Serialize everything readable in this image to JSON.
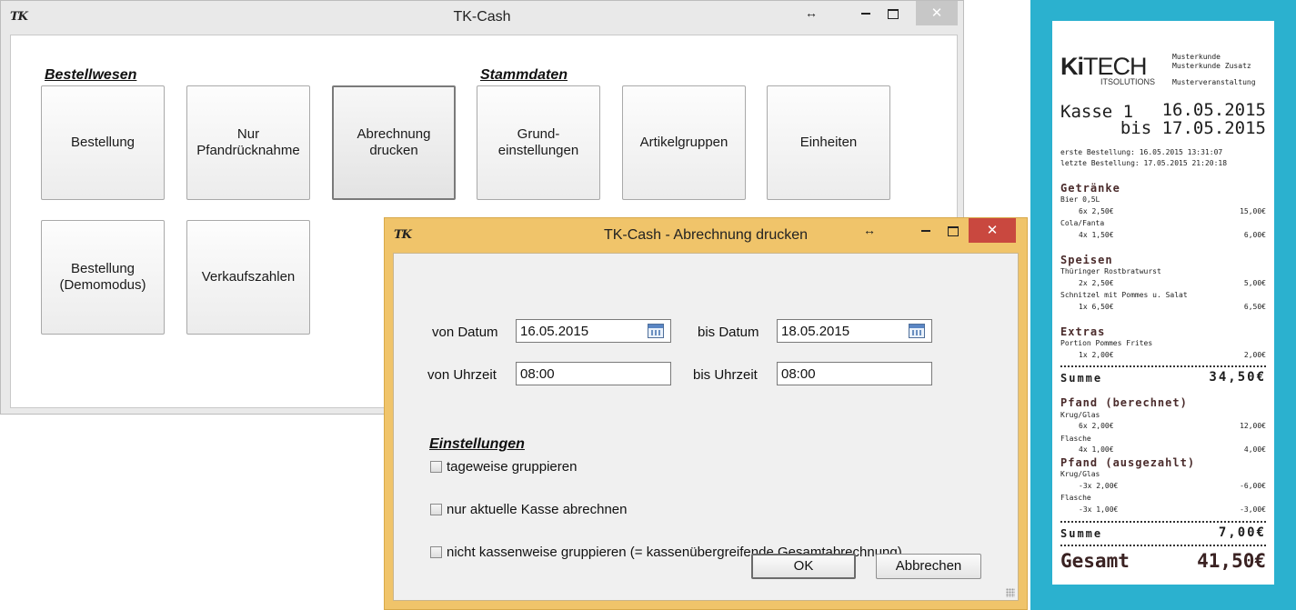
{
  "main_window": {
    "logo": "TK",
    "title": "TK-Cash",
    "controls": {
      "resize": "↔",
      "close": "✕"
    },
    "sections": {
      "bestellwesen": "Bestellwesen",
      "stammdaten": "Stammdaten"
    },
    "tiles": [
      {
        "label": "Bestellung"
      },
      {
        "label": "Nur\nPfandrücknahme"
      },
      {
        "label": "Abrechnung\ndrucken"
      },
      {
        "label": "Grund-\neinstellungen"
      },
      {
        "label": "Artikelgruppen"
      },
      {
        "label": "Einheiten"
      },
      {
        "label": "Bestellung\n(Demomodus)"
      },
      {
        "label": "Verkaufszahlen"
      }
    ]
  },
  "dialog": {
    "logo": "TK",
    "title": "TK-Cash - Abrechnung drucken",
    "controls": {
      "resize": "↔",
      "close": "✕"
    },
    "von_datum": {
      "label": "von Datum",
      "value": "16.05.2015"
    },
    "bis_datum": {
      "label": "bis Datum",
      "value": "18.05.2015"
    },
    "von_uhrzeit": {
      "label": "von Uhrzeit",
      "value": "08:00"
    },
    "bis_uhrzeit": {
      "label": "bis Uhrzeit",
      "value": "08:00"
    },
    "settings_heading": "Einstellungen",
    "checkboxes": [
      {
        "label": "tageweise gruppieren",
        "checked": false
      },
      {
        "label": "nur aktuelle Kasse abrechnen",
        "checked": false
      },
      {
        "label": "nicht kassenweise gruppieren (= kassenübergreifende Gesamtabrechnung)",
        "checked": false
      }
    ],
    "ok_label": "OK",
    "cancel_label": "Abbrechen"
  },
  "receipt": {
    "logo_left": "Ki",
    "logo_right": "TECH",
    "logo_sub": "ITSOLUTIONS",
    "customer_1": "Musterkunde",
    "customer_2": "Musterkunde Zusatz",
    "event": "Musterveranstaltung",
    "register": "Kasse 1",
    "date_from": "16.05.2015",
    "date_to": "bis 17.05.2015",
    "first_order": "erste Bestellung:  16.05.2015 13:31:07",
    "last_order": "letzte Bestellung: 17.05.2015 21:20:18",
    "groups": [
      {
        "name": "Getränke",
        "items": [
          {
            "name": "Bier 0,5L",
            "qty": "6x  2,50€",
            "amount": "15,00€"
          },
          {
            "name": "Cola/Fanta",
            "qty": "4x  1,50€",
            "amount": "6,00€"
          }
        ]
      },
      {
        "name": "Speisen",
        "items": [
          {
            "name": "Thüringer Rostbratwurst",
            "qty": "2x  2,50€",
            "amount": "5,00€"
          },
          {
            "name": "Schnitzel mit Pommes u. Salat",
            "qty": "1x  6,50€",
            "amount": "6,50€"
          }
        ]
      },
      {
        "name": "Extras",
        "items": [
          {
            "name": "Portion Pommes Frites",
            "qty": "1x  2,00€",
            "amount": "2,00€"
          }
        ]
      }
    ],
    "sum_label": "Summe",
    "sum_1": "34,50€",
    "deposit_charged": {
      "name": "Pfand (berechnet)",
      "items": [
        {
          "name": "Krug/Glas",
          "qty": "6x  2,00€",
          "amount": "12,00€"
        },
        {
          "name": "Flasche",
          "qty": "4x  1,00€",
          "amount": "4,00€"
        }
      ]
    },
    "deposit_paid": {
      "name": "Pfand (ausgezahlt)",
      "items": [
        {
          "name": "Krug/Glas",
          "qty": "-3x  2,00€",
          "amount": "-6,00€"
        },
        {
          "name": "Flasche",
          "qty": "-3x  1,00€",
          "amount": "-3,00€"
        }
      ]
    },
    "sum_2": "7,00€",
    "total_label": "Gesamt",
    "total": "41,50€"
  }
}
